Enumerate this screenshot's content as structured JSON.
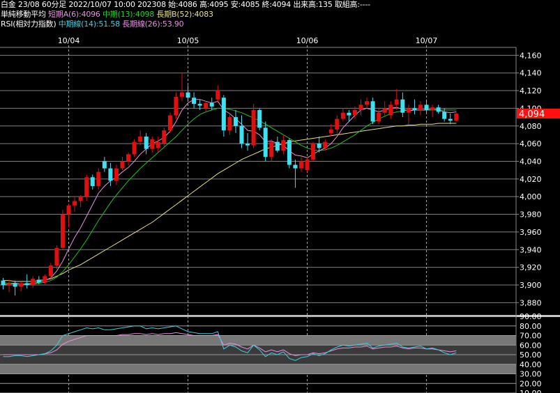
{
  "header": {
    "line1": "白金 23/08 60分足 2022/10/07 10:00 202308 始:4086 高:4095 安:4085 終:4094 出来高:135 取組高:----",
    "ma_label": "単純移動平均",
    "ma_short": "短期A(6):4096",
    "ma_mid": "中期(13):4098",
    "ma_long": "長期B(52):4083",
    "rsi_label": "RSI(相対力指数)",
    "rsi_mid": "中期線(14):51.58",
    "rsi_long": "長期線(26):53.90"
  },
  "colors": {
    "up": "#e01010",
    "down": "#40e0f0",
    "ma_short": "#e890e0",
    "ma_mid": "#20c020",
    "ma_long": "#e8e080",
    "rsi_mid": "#40d0e0",
    "rsi_long": "#e890e0",
    "price_label_bg": "#ff1010"
  },
  "current_price_label": "4,094",
  "chart_data": [
    {
      "type": "candlestick",
      "x_labels": [
        "10/04",
        "10/05",
        "10/06",
        "10/07"
      ],
      "ylim": [
        3870,
        4165
      ],
      "y_ticks": [
        "4,160",
        "4,140",
        "4,120",
        "4,100",
        "4,080",
        "4,060",
        "4,040",
        "4,020",
        "4,000",
        "3,980",
        "3,960",
        "3,940",
        "3,920",
        "3,900",
        "3,880"
      ],
      "y_tick_values": [
        4160,
        4140,
        4120,
        4100,
        4080,
        4060,
        4040,
        4020,
        4000,
        3980,
        3960,
        3940,
        3920,
        3900,
        3880
      ],
      "day_bar_index": [
        11,
        31,
        51,
        71
      ],
      "ohlc": [
        [
          3905,
          3908,
          3895,
          3900
        ],
        [
          3900,
          3906,
          3892,
          3902
        ],
        [
          3902,
          3905,
          3888,
          3898
        ],
        [
          3898,
          3904,
          3893,
          3902
        ],
        [
          3902,
          3912,
          3896,
          3900
        ],
        [
          3900,
          3910,
          3897,
          3907
        ],
        [
          3906,
          3910,
          3901,
          3903
        ],
        [
          3903,
          3912,
          3901,
          3910
        ],
        [
          3910,
          3925,
          3907,
          3922
        ],
        [
          3922,
          3945,
          3918,
          3942
        ],
        [
          3942,
          3985,
          3940,
          3980
        ],
        [
          3980,
          3992,
          3965,
          3990
        ],
        [
          3990,
          4000,
          3983,
          3995
        ],
        [
          3995,
          4002,
          3988,
          4000
        ],
        [
          4000,
          4025,
          3995,
          4022
        ],
        [
          4022,
          4025,
          4008,
          4012
        ],
        [
          4012,
          4032,
          4008,
          4028
        ],
        [
          4040,
          4045,
          4028,
          4032
        ],
        [
          4032,
          4038,
          4012,
          4018
        ],
        [
          4018,
          4036,
          4013,
          4032
        ],
        [
          4032,
          4045,
          4030,
          4040
        ],
        [
          4040,
          4050,
          4035,
          4048
        ],
        [
          4048,
          4065,
          4045,
          4062
        ],
        [
          4062,
          4075,
          4058,
          4068
        ],
        [
          4068,
          4072,
          4048,
          4054
        ],
        [
          4054,
          4068,
          4050,
          4065
        ],
        [
          4055,
          4068,
          4050,
          4062
        ],
        [
          4060,
          4078,
          4055,
          4075
        ],
        [
          4075,
          4095,
          4072,
          4092
        ],
        [
          4092,
          4118,
          4088,
          4113
        ],
        [
          4113,
          4140,
          4108,
          4118
        ],
        [
          4118,
          4126,
          4108,
          4112
        ],
        [
          4112,
          4118,
          4100,
          4105
        ],
        [
          4105,
          4110,
          4098,
          4103
        ],
        [
          4100,
          4108,
          4095,
          4106
        ],
        [
          4106,
          4112,
          4098,
          4102
        ],
        [
          4110,
          4126,
          4106,
          4120
        ],
        [
          4112,
          4115,
          4068,
          4075
        ],
        [
          4075,
          4094,
          4070,
          4090
        ],
        [
          4090,
          4098,
          4072,
          4080
        ],
        [
          4080,
          4092,
          4055,
          4060
        ],
        [
          4060,
          4072,
          4052,
          4058
        ],
        [
          4058,
          4105,
          4055,
          4098
        ],
        [
          4098,
          4100,
          4075,
          4078
        ],
        [
          4078,
          4085,
          4040,
          4045
        ],
        [
          4045,
          4065,
          4040,
          4062
        ],
        [
          4062,
          4068,
          4050,
          4052
        ],
        [
          4052,
          4070,
          4048,
          4064
        ],
        [
          4064,
          4066,
          4032,
          4036
        ],
        [
          4036,
          4042,
          4010,
          4032
        ],
        [
          4032,
          4045,
          4028,
          4040
        ],
        [
          4030,
          4045,
          4028,
          4042
        ],
        [
          4042,
          4062,
          4040,
          4060
        ],
        [
          4060,
          4068,
          4050,
          4055
        ],
        [
          4055,
          4065,
          4052,
          4062
        ],
        [
          4072,
          4082,
          4068,
          4076
        ],
        [
          4076,
          4092,
          4070,
          4088
        ],
        [
          4088,
          4100,
          4085,
          4095
        ],
        [
          4095,
          4098,
          4085,
          4092
        ],
        [
          4092,
          4102,
          4088,
          4098
        ],
        [
          4098,
          4110,
          4092,
          4104
        ],
        [
          4104,
          4112,
          4100,
          4108
        ],
        [
          4108,
          4112,
          4082,
          4085
        ],
        [
          4085,
          4100,
          4082,
          4095
        ],
        [
          4095,
          4108,
          4090,
          4100
        ],
        [
          4092,
          4108,
          4088,
          4104
        ],
        [
          4104,
          4122,
          4098,
          4110
        ],
        [
          4110,
          4118,
          4090,
          4095
        ],
        [
          4095,
          4104,
          4082,
          4100
        ],
        [
          4100,
          4110,
          4093,
          4098
        ],
        [
          4098,
          4108,
          4092,
          4104
        ],
        [
          4104,
          4110,
          4095,
          4098
        ],
        [
          4098,
          4104,
          4090,
          4101
        ],
        [
          4101,
          4104,
          4094,
          4096
        ],
        [
          4096,
          4100,
          4085,
          4088
        ],
        [
          4088,
          4094,
          4082,
          4086
        ],
        [
          4086,
          4095,
          4085,
          4094
        ]
      ],
      "ma_short_series": [
        3900,
        3901,
        3902,
        3901,
        3901,
        3902,
        3903,
        3905,
        3908,
        3916,
        3927,
        3941,
        3954,
        3965,
        3978,
        3991,
        4004,
        4012,
        4018,
        4022,
        4028,
        4033,
        4040,
        4048,
        4054,
        4060,
        4063,
        4067,
        4074,
        4085,
        4098,
        4106,
        4110,
        4110,
        4108,
        4106,
        4108,
        4098,
        4094,
        4088,
        4082,
        4075,
        4074,
        4070,
        4062,
        4063,
        4060,
        4058,
        4052,
        4047,
        4046,
        4044,
        4048,
        4052,
        4055,
        4060,
        4068,
        4078,
        4085,
        4092,
        4098,
        4100,
        4098,
        4096,
        4098,
        4100,
        4101,
        4099,
        4097,
        4098,
        4098,
        4098,
        4099,
        4098,
        4096,
        4095,
        4096
      ],
      "ma_mid_series": [
        3902,
        3902,
        3902,
        3901,
        3901,
        3901,
        3902,
        3903,
        3905,
        3909,
        3915,
        3923,
        3932,
        3941,
        3951,
        3962,
        3973,
        3983,
        3993,
        4002,
        4010,
        4018,
        4025,
        4032,
        4038,
        4044,
        4050,
        4056,
        4062,
        4068,
        4075,
        4082,
        4088,
        4093,
        4096,
        4098,
        4100,
        4100,
        4099,
        4097,
        4095,
        4092,
        4089,
        4086,
        4082,
        4078,
        4074,
        4070,
        4066,
        4062,
        4058,
        4055,
        4053,
        4052,
        4053,
        4055,
        4058,
        4062,
        4066,
        4070,
        4075,
        4080,
        4084,
        4088,
        4091,
        4094,
        4096,
        4097,
        4098,
        4098,
        4098,
        4098,
        4098,
        4098,
        4098,
        4098,
        4098
      ],
      "ma_long_series": [
        3905,
        3905,
        3904,
        3904,
        3904,
        3904,
        3905,
        3906,
        3907,
        3910,
        3913,
        3917,
        3920,
        3923,
        3927,
        3931,
        3935,
        3939,
        3943,
        3947,
        3951,
        3955,
        3959,
        3963,
        3967,
        3971,
        3976,
        3981,
        3986,
        3991,
        3996,
        4001,
        4006,
        4011,
        4016,
        4021,
        4026,
        4030,
        4034,
        4038,
        4042,
        4045,
        4048,
        4051,
        4054,
        4056,
        4058,
        4060,
        4062,
        4063,
        4064,
        4065,
        4066,
        4067,
        4068,
        4069,
        4070,
        4071,
        4072,
        4073,
        4074,
        4075,
        4076,
        4077,
        4078,
        4079,
        4080,
        4080,
        4081,
        4081,
        4082,
        4082,
        4082,
        4083,
        4083,
        4083,
        4083
      ]
    },
    {
      "type": "line",
      "title": "RSI",
      "ylim": [
        10,
        90
      ],
      "y_ticks": [
        "90.00",
        "80.00",
        "70.00",
        "60.00",
        "50.00",
        "40.00",
        "30.00",
        "20.00",
        "10.00"
      ],
      "y_tick_values": [
        90,
        80,
        70,
        60,
        50,
        40,
        30,
        20,
        10
      ],
      "series": [
        {
          "name": "中期線(14)",
          "values": [
            48,
            48,
            49,
            49,
            48,
            49,
            50,
            51,
            54,
            60,
            70,
            72,
            74,
            76,
            78,
            77,
            78,
            76,
            76,
            77,
            78,
            79,
            80,
            80,
            77,
            78,
            77,
            78,
            79,
            80,
            77,
            74,
            73,
            72,
            72,
            72,
            74,
            56,
            60,
            58,
            54,
            52,
            60,
            55,
            48,
            52,
            50,
            53,
            46,
            44,
            47,
            48,
            51,
            49,
            51,
            55,
            58,
            60,
            59,
            60,
            61,
            62,
            57,
            59,
            60,
            61,
            62,
            58,
            57,
            58,
            59,
            56,
            57,
            55,
            52,
            50,
            52
          ]
        },
        {
          "name": "長期線(26)",
          "values": [
            50,
            50,
            50,
            50,
            50,
            50,
            50,
            51,
            52,
            55,
            61,
            64,
            66,
            68,
            70,
            70,
            70,
            70,
            70,
            70,
            71,
            71,
            72,
            72,
            71,
            72,
            71,
            72,
            72,
            73,
            72,
            71,
            70,
            70,
            70,
            70,
            71,
            60,
            62,
            61,
            58,
            56,
            60,
            57,
            53,
            55,
            53,
            55,
            51,
            49,
            50,
            50,
            52,
            51,
            52,
            54,
            56,
            57,
            57,
            58,
            58,
            59,
            56,
            57,
            58,
            58,
            59,
            57,
            56,
            57,
            57,
            56,
            56,
            55,
            54,
            53,
            54
          ]
        }
      ]
    }
  ]
}
